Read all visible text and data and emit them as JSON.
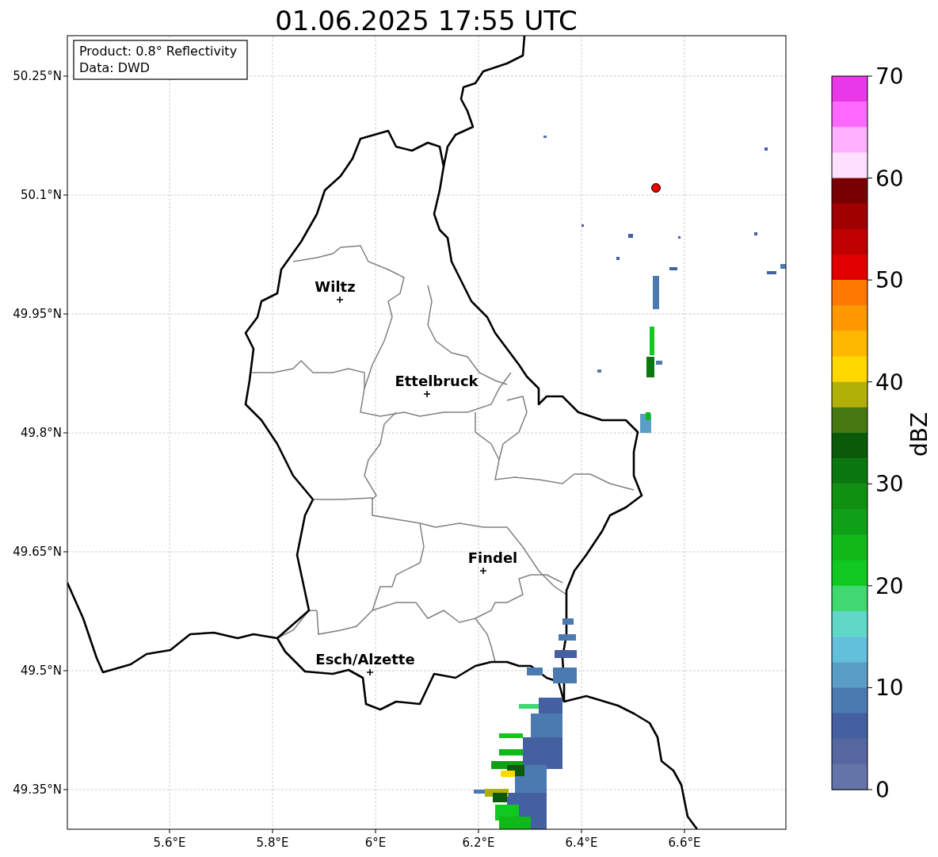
{
  "title": "01.06.2025 17:55 UTC",
  "info_box": {
    "lines": [
      "Product: 0.8° Reflectivity",
      "Data: DWD"
    ]
  },
  "map": {
    "xticks": [
      "5.6°E",
      "5.8°E",
      "6°E",
      "6.2°E",
      "6.4°E",
      "6.6°E"
    ],
    "yticks": [
      "50.25°N",
      "50.1°N",
      "49.95°N",
      "49.8°N",
      "49.65°N",
      "49.5°N",
      "49.35°N"
    ],
    "cities": [
      {
        "name": "Wiltz"
      },
      {
        "name": "Ettelbruck"
      },
      {
        "name": "Findel"
      },
      {
        "name": "Esch/Alzette"
      }
    ]
  },
  "colorbar": {
    "label": "dBZ",
    "ticks": [
      "70",
      "60",
      "50",
      "40",
      "30",
      "20",
      "10",
      "0"
    ],
    "bins": [
      {
        "color": "#e838e8"
      },
      {
        "color": "#ff68ff"
      },
      {
        "color": "#ffb0ff"
      },
      {
        "color": "#ffe0ff"
      },
      {
        "color": "#780000"
      },
      {
        "color": "#a00000"
      },
      {
        "color": "#c00000"
      },
      {
        "color": "#e00000"
      },
      {
        "color": "#ff7800"
      },
      {
        "color": "#ff9800"
      },
      {
        "color": "#ffb800"
      },
      {
        "color": "#ffd800"
      },
      {
        "color": "#b0b008"
      },
      {
        "color": "#467810"
      },
      {
        "color": "#0a5a0a"
      },
      {
        "color": "#0a7810"
      },
      {
        "color": "#109010"
      },
      {
        "color": "#10a018"
      },
      {
        "color": "#10b818"
      },
      {
        "color": "#10c820"
      },
      {
        "color": "#40d870"
      },
      {
        "color": "#60d8c8"
      },
      {
        "color": "#62c0dc"
      },
      {
        "color": "#5a9ec8"
      },
      {
        "color": "#4a7ab0"
      },
      {
        "color": "#4560a0"
      },
      {
        "color": "#55679e"
      },
      {
        "color": "#6473a8"
      }
    ]
  }
}
